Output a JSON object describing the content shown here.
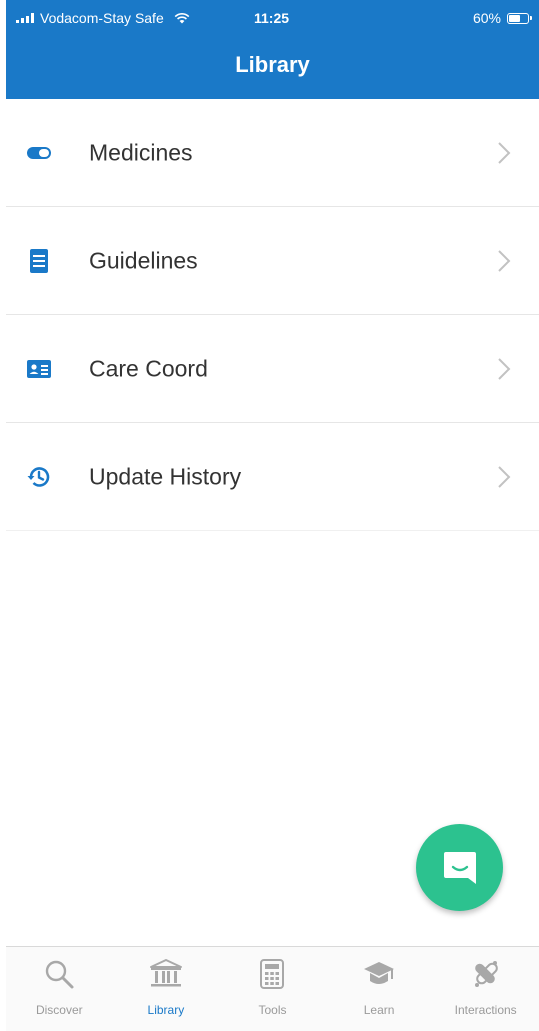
{
  "status_bar": {
    "carrier": "Vodacom-Stay Safe",
    "time": "11:25",
    "battery": "60%",
    "battery_level": 0.6
  },
  "header": {
    "title": "Library"
  },
  "colors": {
    "accent": "#1a79c8",
    "fab": "#2cc28f",
    "tab_inactive": "#9a9a9a"
  },
  "list": {
    "items": [
      {
        "label": "Medicines",
        "icon": "pill-icon"
      },
      {
        "label": "Guidelines",
        "icon": "document-icon"
      },
      {
        "label": "Care Coord",
        "icon": "id-card-icon"
      },
      {
        "label": "Update History",
        "icon": "history-icon"
      }
    ]
  },
  "fab": {
    "icon": "chat-bubble-icon"
  },
  "tabbar": {
    "active": "Library",
    "tabs": [
      {
        "label": "Discover",
        "icon": "search-icon"
      },
      {
        "label": "Library",
        "icon": "library-icon"
      },
      {
        "label": "Tools",
        "icon": "calculator-icon"
      },
      {
        "label": "Learn",
        "icon": "graduation-cap-icon"
      },
      {
        "label": "Interactions",
        "icon": "pills-interaction-icon"
      }
    ]
  }
}
